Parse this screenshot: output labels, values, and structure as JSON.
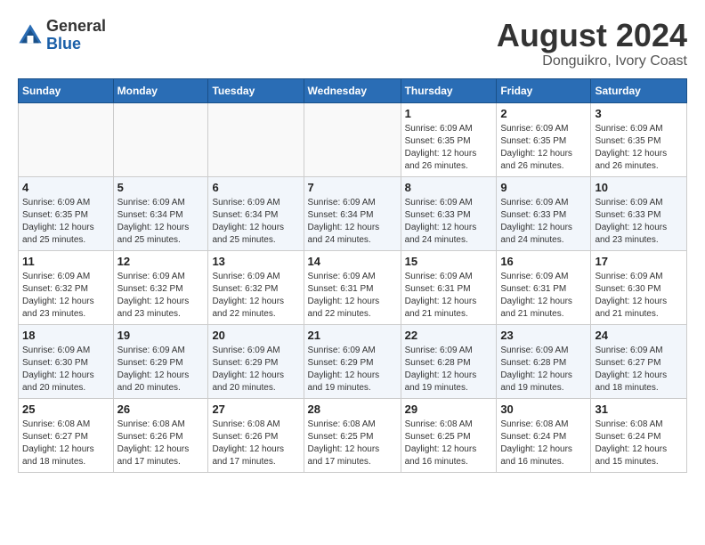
{
  "header": {
    "logo_general": "General",
    "logo_blue": "Blue",
    "month_year": "August 2024",
    "location": "Donguikro, Ivory Coast"
  },
  "days_of_week": [
    "Sunday",
    "Monday",
    "Tuesday",
    "Wednesday",
    "Thursday",
    "Friday",
    "Saturday"
  ],
  "weeks": [
    [
      {
        "day": "",
        "info": ""
      },
      {
        "day": "",
        "info": ""
      },
      {
        "day": "",
        "info": ""
      },
      {
        "day": "",
        "info": ""
      },
      {
        "day": "1",
        "info": "Sunrise: 6:09 AM\nSunset: 6:35 PM\nDaylight: 12 hours\nand 26 minutes."
      },
      {
        "day": "2",
        "info": "Sunrise: 6:09 AM\nSunset: 6:35 PM\nDaylight: 12 hours\nand 26 minutes."
      },
      {
        "day": "3",
        "info": "Sunrise: 6:09 AM\nSunset: 6:35 PM\nDaylight: 12 hours\nand 26 minutes."
      }
    ],
    [
      {
        "day": "4",
        "info": "Sunrise: 6:09 AM\nSunset: 6:35 PM\nDaylight: 12 hours\nand 25 minutes."
      },
      {
        "day": "5",
        "info": "Sunrise: 6:09 AM\nSunset: 6:34 PM\nDaylight: 12 hours\nand 25 minutes."
      },
      {
        "day": "6",
        "info": "Sunrise: 6:09 AM\nSunset: 6:34 PM\nDaylight: 12 hours\nand 25 minutes."
      },
      {
        "day": "7",
        "info": "Sunrise: 6:09 AM\nSunset: 6:34 PM\nDaylight: 12 hours\nand 24 minutes."
      },
      {
        "day": "8",
        "info": "Sunrise: 6:09 AM\nSunset: 6:33 PM\nDaylight: 12 hours\nand 24 minutes."
      },
      {
        "day": "9",
        "info": "Sunrise: 6:09 AM\nSunset: 6:33 PM\nDaylight: 12 hours\nand 24 minutes."
      },
      {
        "day": "10",
        "info": "Sunrise: 6:09 AM\nSunset: 6:33 PM\nDaylight: 12 hours\nand 23 minutes."
      }
    ],
    [
      {
        "day": "11",
        "info": "Sunrise: 6:09 AM\nSunset: 6:32 PM\nDaylight: 12 hours\nand 23 minutes."
      },
      {
        "day": "12",
        "info": "Sunrise: 6:09 AM\nSunset: 6:32 PM\nDaylight: 12 hours\nand 23 minutes."
      },
      {
        "day": "13",
        "info": "Sunrise: 6:09 AM\nSunset: 6:32 PM\nDaylight: 12 hours\nand 22 minutes."
      },
      {
        "day": "14",
        "info": "Sunrise: 6:09 AM\nSunset: 6:31 PM\nDaylight: 12 hours\nand 22 minutes."
      },
      {
        "day": "15",
        "info": "Sunrise: 6:09 AM\nSunset: 6:31 PM\nDaylight: 12 hours\nand 21 minutes."
      },
      {
        "day": "16",
        "info": "Sunrise: 6:09 AM\nSunset: 6:31 PM\nDaylight: 12 hours\nand 21 minutes."
      },
      {
        "day": "17",
        "info": "Sunrise: 6:09 AM\nSunset: 6:30 PM\nDaylight: 12 hours\nand 21 minutes."
      }
    ],
    [
      {
        "day": "18",
        "info": "Sunrise: 6:09 AM\nSunset: 6:30 PM\nDaylight: 12 hours\nand 20 minutes."
      },
      {
        "day": "19",
        "info": "Sunrise: 6:09 AM\nSunset: 6:29 PM\nDaylight: 12 hours\nand 20 minutes."
      },
      {
        "day": "20",
        "info": "Sunrise: 6:09 AM\nSunset: 6:29 PM\nDaylight: 12 hours\nand 20 minutes."
      },
      {
        "day": "21",
        "info": "Sunrise: 6:09 AM\nSunset: 6:29 PM\nDaylight: 12 hours\nand 19 minutes."
      },
      {
        "day": "22",
        "info": "Sunrise: 6:09 AM\nSunset: 6:28 PM\nDaylight: 12 hours\nand 19 minutes."
      },
      {
        "day": "23",
        "info": "Sunrise: 6:09 AM\nSunset: 6:28 PM\nDaylight: 12 hours\nand 19 minutes."
      },
      {
        "day": "24",
        "info": "Sunrise: 6:09 AM\nSunset: 6:27 PM\nDaylight: 12 hours\nand 18 minutes."
      }
    ],
    [
      {
        "day": "25",
        "info": "Sunrise: 6:08 AM\nSunset: 6:27 PM\nDaylight: 12 hours\nand 18 minutes."
      },
      {
        "day": "26",
        "info": "Sunrise: 6:08 AM\nSunset: 6:26 PM\nDaylight: 12 hours\nand 17 minutes."
      },
      {
        "day": "27",
        "info": "Sunrise: 6:08 AM\nSunset: 6:26 PM\nDaylight: 12 hours\nand 17 minutes."
      },
      {
        "day": "28",
        "info": "Sunrise: 6:08 AM\nSunset: 6:25 PM\nDaylight: 12 hours\nand 17 minutes."
      },
      {
        "day": "29",
        "info": "Sunrise: 6:08 AM\nSunset: 6:25 PM\nDaylight: 12 hours\nand 16 minutes."
      },
      {
        "day": "30",
        "info": "Sunrise: 6:08 AM\nSunset: 6:24 PM\nDaylight: 12 hours\nand 16 minutes."
      },
      {
        "day": "31",
        "info": "Sunrise: 6:08 AM\nSunset: 6:24 PM\nDaylight: 12 hours\nand 15 minutes."
      }
    ]
  ]
}
